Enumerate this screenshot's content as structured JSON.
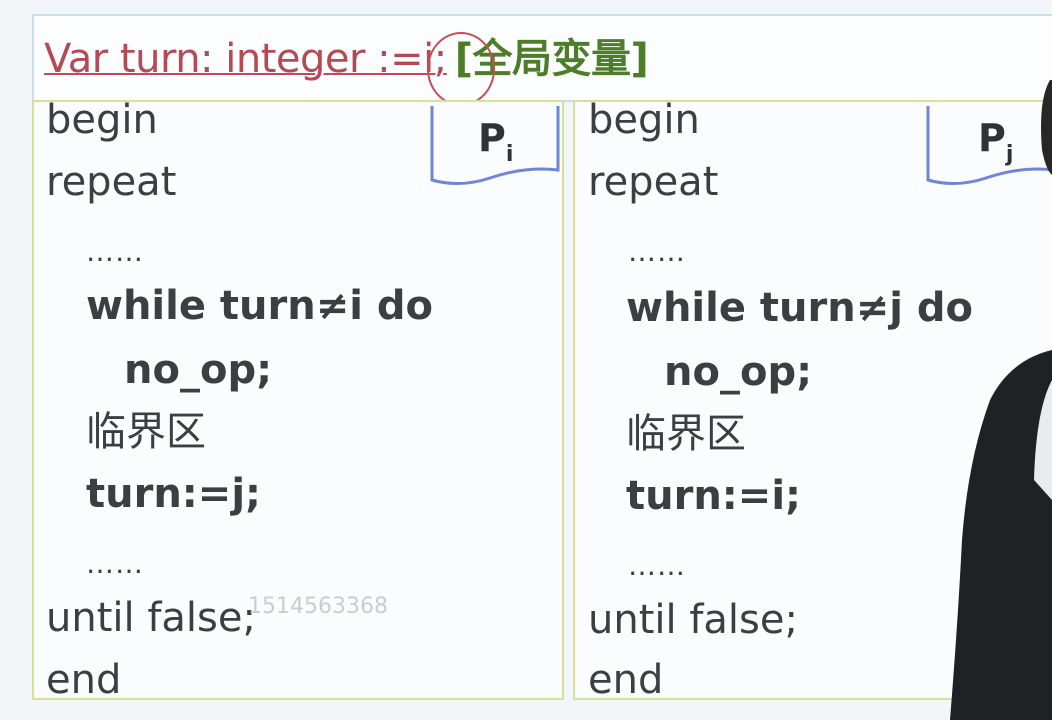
{
  "header": {
    "declaration": "Var turn: integer :=i;",
    "note": "[全局变量]"
  },
  "panels": {
    "left": {
      "tag_letter": "P",
      "tag_sub": "i",
      "lines": [
        "begin",
        "repeat",
        "……",
        "while turn≠i  do",
        "no_op;",
        "临界区",
        "turn:=j;",
        "……",
        "until false;",
        "end"
      ]
    },
    "right": {
      "tag_letter": "P",
      "tag_sub": "j",
      "lines": [
        "begin",
        "repeat",
        "……",
        "while turn≠j do",
        "no_op;",
        "临界区",
        "turn:=i;",
        "……",
        "until false;",
        "end"
      ]
    }
  },
  "watermark": "1514563368",
  "colors": {
    "declaration": "#b54a55",
    "note": "#4d7d28",
    "panel_border": "#d6e09a",
    "tag_border": "#6f86d8"
  }
}
